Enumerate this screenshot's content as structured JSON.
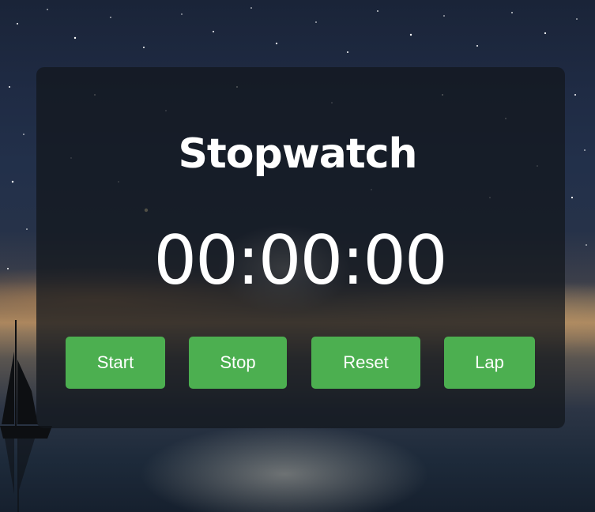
{
  "app": {
    "title": "Stopwatch",
    "time_display": "00:00:00"
  },
  "controls": {
    "start_label": "Start",
    "stop_label": "Stop",
    "reset_label": "Reset",
    "lap_label": "Lap"
  },
  "colors": {
    "button": "#4caf50",
    "panel": "rgba(18,22,28,0.72)",
    "text": "#ffffff"
  },
  "background": {
    "icon": "night-sky-sailboat-image"
  }
}
